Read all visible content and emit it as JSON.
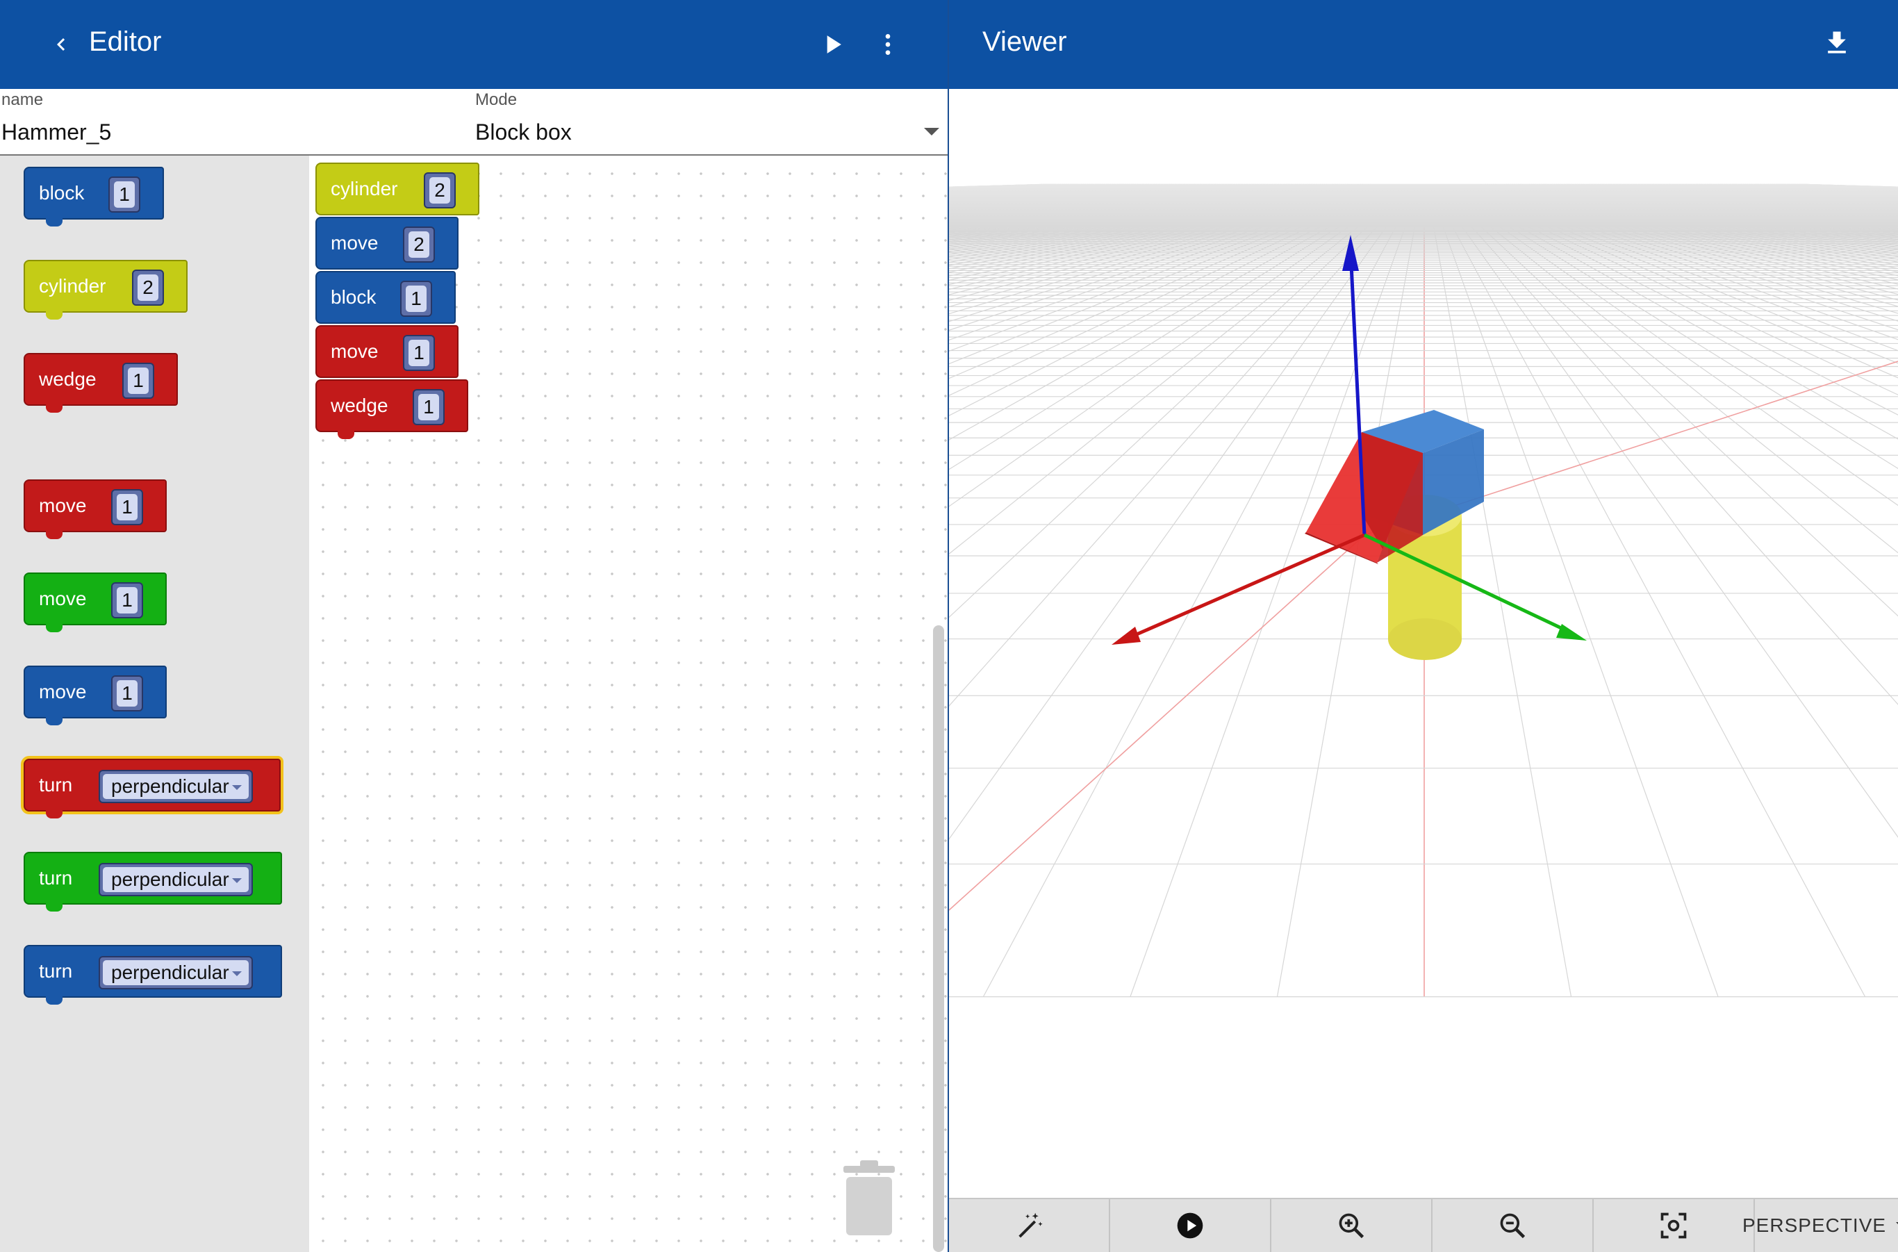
{
  "editor": {
    "title": "Editor",
    "back_icon": "chevron-left-icon",
    "run_icon": "play-icon",
    "menu_icon": "more-vert-icon"
  },
  "viewer": {
    "title": "Viewer",
    "download_icon": "download-icon"
  },
  "form": {
    "name_label": "name",
    "name_value": "Hammer_5",
    "mode_label": "Mode",
    "mode_value": "Block box"
  },
  "toolbox": {
    "block_label": "block",
    "block_value": "1",
    "cylinder_label": "cylinder",
    "cylinder_value": "2",
    "wedge_label": "wedge",
    "wedge_value": "1",
    "move_red_label": "move",
    "move_red_value": "1",
    "move_green_label": "move",
    "move_green_value": "1",
    "move_blue_label": "move",
    "move_blue_value": "1",
    "turn_red_label": "turn",
    "turn_red_value": "perpendicular",
    "turn_green_label": "turn",
    "turn_green_value": "perpendicular",
    "turn_blue_label": "turn",
    "turn_blue_value": "perpendicular"
  },
  "workspace": {
    "stack": [
      {
        "label": "cylinder",
        "value": "2",
        "color": "yellow"
      },
      {
        "label": "move",
        "value": "2",
        "color": "blue"
      },
      {
        "label": "block",
        "value": "1",
        "color": "blue"
      },
      {
        "label": "move",
        "value": "1",
        "color": "red"
      },
      {
        "label": "wedge",
        "value": "1",
        "color": "red"
      }
    ],
    "trash_icon": "trash-icon"
  },
  "viewer_toolbar": {
    "magic_icon": "magic-wand-icon",
    "play_icon": "play-circle-icon",
    "zoom_in_icon": "zoom-in-icon",
    "zoom_out_icon": "zoom-out-icon",
    "focus_icon": "focus-icon",
    "camera_mode": "PERSPECTIVE"
  },
  "colors": {
    "app_bar": "#0d51a3",
    "block_blue": "#1a58a8",
    "block_yellow": "#c4cc16",
    "block_red": "#c21a1a",
    "block_green": "#14b014"
  }
}
